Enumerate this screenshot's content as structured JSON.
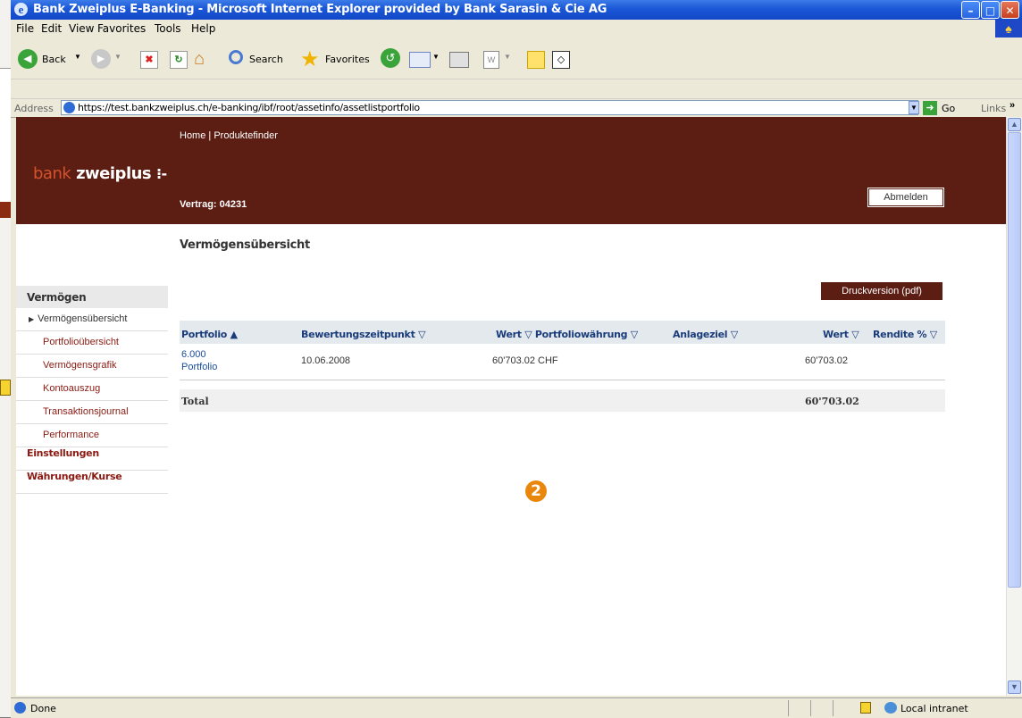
{
  "window": {
    "title": "Bank Zweiplus E-Banking - Microsoft Internet Explorer provided by Bank Sarasin & Cie AG"
  },
  "menu": [
    "File",
    "Edit",
    "View",
    "Favorites",
    "Tools",
    "Help"
  ],
  "toolbar": {
    "back_label": "Back",
    "search_label": "Search",
    "favorites_label": "Favorites"
  },
  "address": {
    "label": "Address",
    "url": "https://test.bankzweiplus.ch/e-banking/ibf/root/assetinfo/assetlistportfolio",
    "go_label": "Go",
    "links_label": "Links"
  },
  "page": {
    "topnav": {
      "home": "Home",
      "separator": "|",
      "product_finder": "Produktefinder"
    },
    "brand": {
      "part1": "bank",
      "part2": "zweiplus"
    },
    "contract": "Vertrag: 04231",
    "logout_label": "Abmelden",
    "title": "Vermögensübersicht",
    "print_label": "Druckversion (pdf)",
    "sidebar": {
      "heading": "Vermögen",
      "items": [
        "Vermögensübersicht",
        "Portfolioübersicht",
        "Vermögensgrafik",
        "Kontoauszug",
        "Transaktionsjournal",
        "Performance"
      ],
      "sections": [
        "Einstellungen",
        "Währungen/Kurse"
      ]
    },
    "table": {
      "headers": {
        "portfolio": "Portfolio ▲",
        "valuation": "Bewertungszeitpunkt ▽",
        "value_currency": "Wert ▽ Portfoliowährung ▽",
        "target": "Anlageziel ▽",
        "value": "Wert ▽",
        "return": "Rendite % ▽"
      },
      "row": {
        "portfolio_id": "6.000",
        "portfolio_name": "Portfolio",
        "date": "10.06.2008",
        "value_currency": "60'703.02 CHF",
        "value": "60'703.02"
      },
      "total_label": "Total",
      "total_value": "60'703.02"
    },
    "badge": "2"
  },
  "status": {
    "text": "Done",
    "zone": "Local intranet"
  }
}
